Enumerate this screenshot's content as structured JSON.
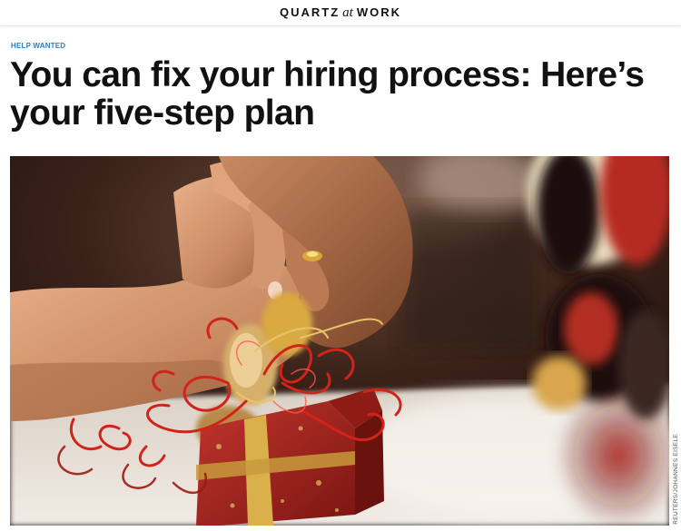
{
  "header": {
    "brand_left": "QUARTZ",
    "brand_at": "at",
    "brand_right": "WORK"
  },
  "article": {
    "kicker": "HELP WANTED",
    "headline": "You can fix your hiring process: Here’s your five-step plan",
    "image_credit": "REUTERS/JOHANNES EISELE"
  },
  "colors": {
    "kicker": "#2c7ec2",
    "headline": "#111111",
    "background": "#ffffff"
  }
}
